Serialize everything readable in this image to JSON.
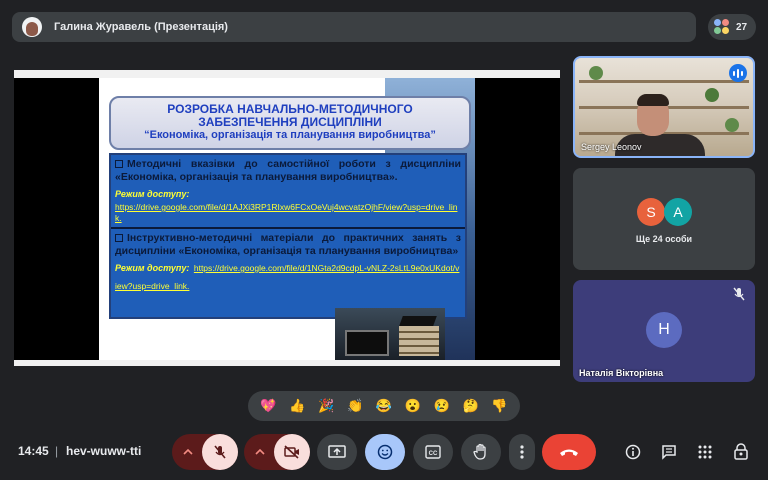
{
  "topbar": {
    "presenter_label": "Галина Журавель (Презентація)",
    "participant_count": "27"
  },
  "share": {
    "slide": {
      "title_line1": "РОЗРОБКА НАВЧАЛЬНО-МЕТОДИЧНОГО",
      "title_line2": "ЗАБЕЗПЕЧЕННЯ ДИСЦИПЛІНИ",
      "title_line3": "“Економіка, організація та планування виробництва”",
      "items": [
        {
          "text": "Методичні вказівки до самостійної роботи з дисципліни «Економіка, організація та планування виробництва».",
          "access_label": "Режим доступу:",
          "link": "https://drive.google.com/file/d/1AJXi3RP1RIxw6FCxOeVuj4wcvatzOjhF/view?usp=drive_link."
        },
        {
          "text": "Інструктивно-методичні матеріали до практичних занять з дисципліни «Економіка, організація та планування виробництва»",
          "access_label": "Режим доступу:",
          "link": "https://drive.google.com/file/d/1NGta2d9cdpL-vNLZ-2sLtL9e0xUKdot/view?usp=drive_link."
        }
      ]
    }
  },
  "participants": {
    "tile1_name": "Sergey Leonov",
    "tile2_avatars": [
      {
        "letter": "S",
        "color": "#e8623c"
      },
      {
        "letter": "A",
        "color": "#12a4a4"
      }
    ],
    "tile2_caption": "Ще 24 особи",
    "tile3_avatar_letter": "Н",
    "tile3_name": "Наталія Вікторівна"
  },
  "reactions": [
    "💖",
    "👍",
    "🎉",
    "👏",
    "😂",
    "😮",
    "😢",
    "🤔",
    "👎"
  ],
  "bottombar": {
    "time": "14:45",
    "separator": "|",
    "meeting_code": "hev-wuww-tti"
  },
  "colors": {
    "accent_blue": "#8ab4f8",
    "muted_red": "#f9dedc",
    "end_call": "#ea4335"
  }
}
